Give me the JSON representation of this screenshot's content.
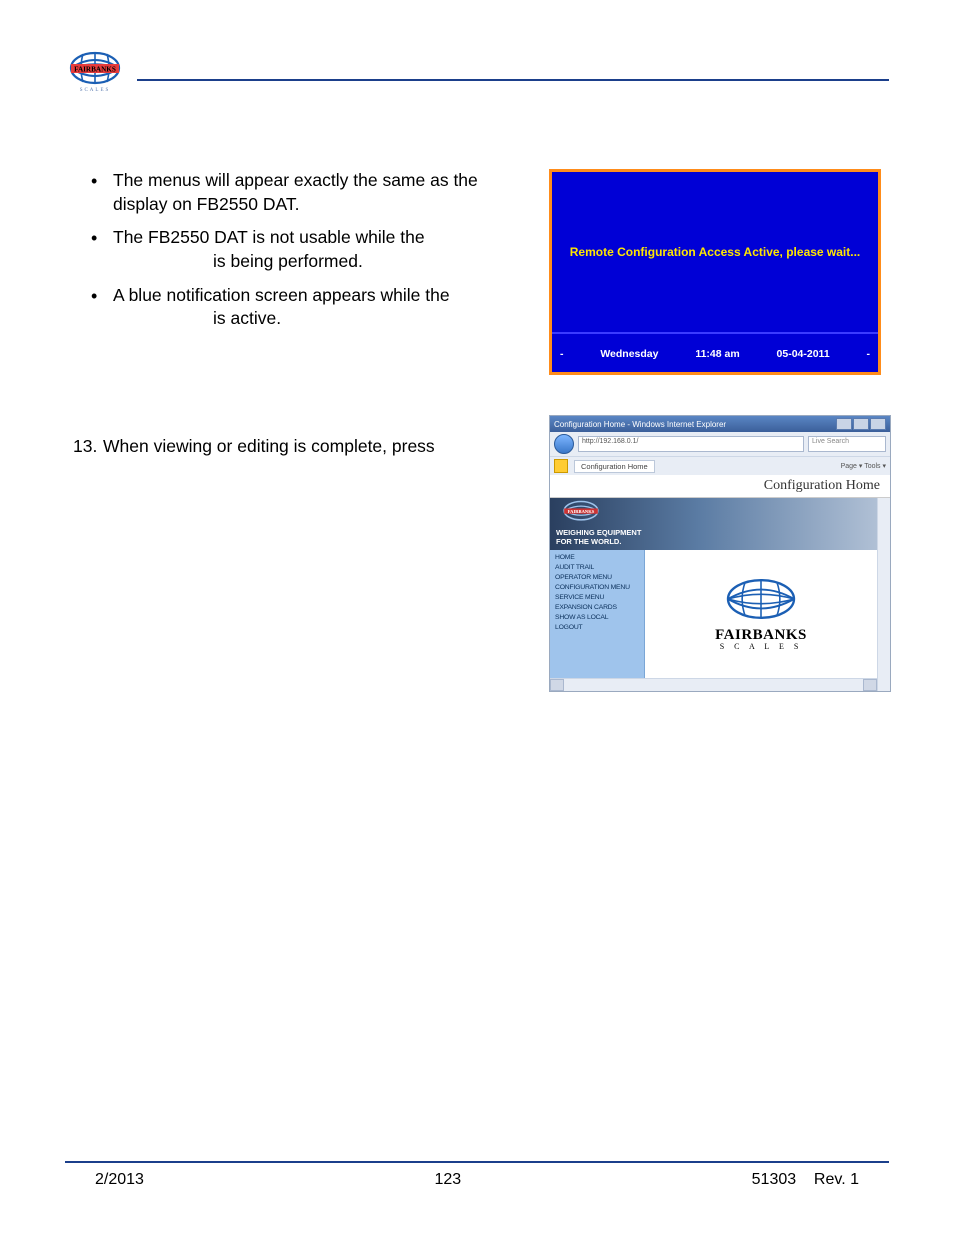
{
  "brand": {
    "name": "FAIRBANKS",
    "sub": "SCALES"
  },
  "bullets": {
    "b1": "The menus will appear exactly the same as the display on FB2550 DAT.",
    "b2a": "The FB2550 DAT is not usable while the",
    "b2b": "is being performed.",
    "b3a": "A blue notification screen appears while the",
    "b3b": "is active."
  },
  "step13": {
    "num": "13.",
    "text": "When viewing or editing is complete, press"
  },
  "bluescreen": {
    "msg": "Remote Configuration Access Active, please wait...",
    "day": "Wednesday",
    "time": "11:48 am",
    "date": "05-04-2011",
    "dash": "-"
  },
  "ie": {
    "title": "Configuration Home - Windows Internet Explorer",
    "url": "http://192.168.0.1/",
    "search_placeholder": "Live Search",
    "tab": "Configuration Home",
    "tools": "Page ▾   Tools ▾",
    "heading": "Configuration Home",
    "tagline1": "WEIGHING EQUIPMENT",
    "tagline2": "FOR THE WORLD.",
    "menu": [
      "HOME",
      "AUDIT TRAIL",
      "OPERATOR MENU",
      "CONFIGURATION MENU",
      "SERVICE MENU",
      "EXPANSION CARDS",
      "SHOW AS LOCAL",
      "LOGOUT"
    ],
    "brand": "FAIRBANKS",
    "brand_sub": "S C A L E S"
  },
  "footer": {
    "date": "2/2013",
    "page": "123",
    "doc": "51303",
    "rev": "Rev. 1"
  }
}
